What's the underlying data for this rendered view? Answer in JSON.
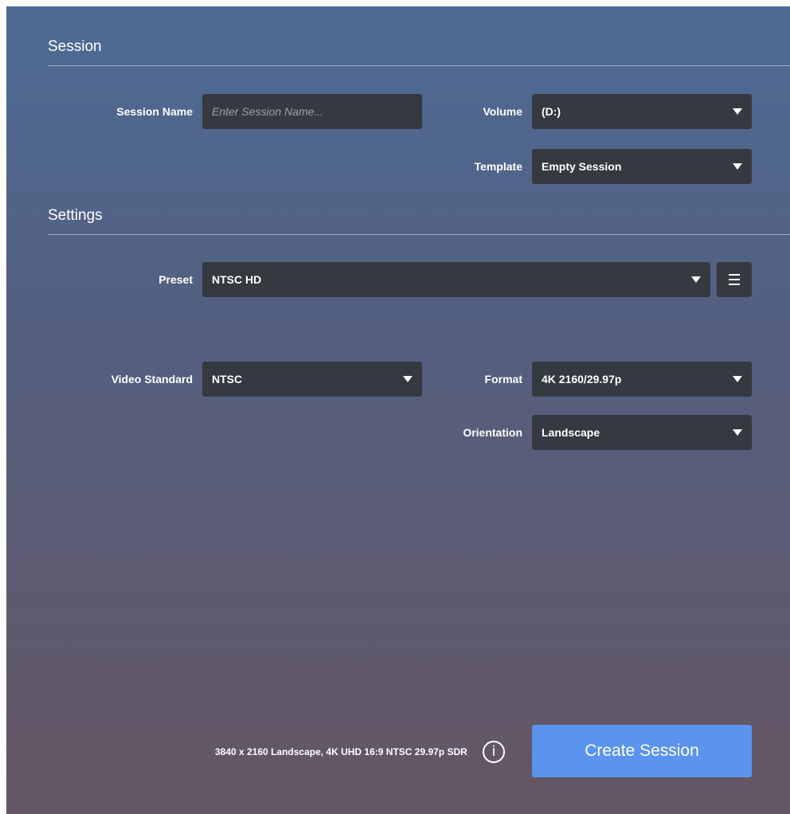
{
  "session_section": {
    "title": "Session",
    "name_label": "Session Name",
    "name_placeholder": "Enter Session Name...",
    "name_value": "",
    "volume_label": "Volume",
    "volume_value": "(D:)",
    "template_label": "Template",
    "template_value": "Empty Session"
  },
  "settings_section": {
    "title": "Settings",
    "preset_label": "Preset",
    "preset_value": "NTSC HD",
    "video_standard_label": "Video Standard",
    "video_standard_value": "NTSC",
    "format_label": "Format",
    "format_value": "4K 2160/29.97p",
    "orientation_label": "Orientation",
    "orientation_value": "Landscape"
  },
  "footer": {
    "summary": "3840 x 2160 Landscape, 4K UHD 16:9 NTSC 29.97p SDR",
    "info_icon_glyph": "i",
    "create_label": "Create Session"
  },
  "colors": {
    "field_bg": "#343a3f",
    "accent": "#5b93f0",
    "panel_top": "#4d6b94",
    "panel_bottom": "#655663"
  },
  "icons": {
    "dropdown": "caret-down-icon",
    "preset_menu": "hamburger-menu-icon",
    "info": "info-icon"
  }
}
